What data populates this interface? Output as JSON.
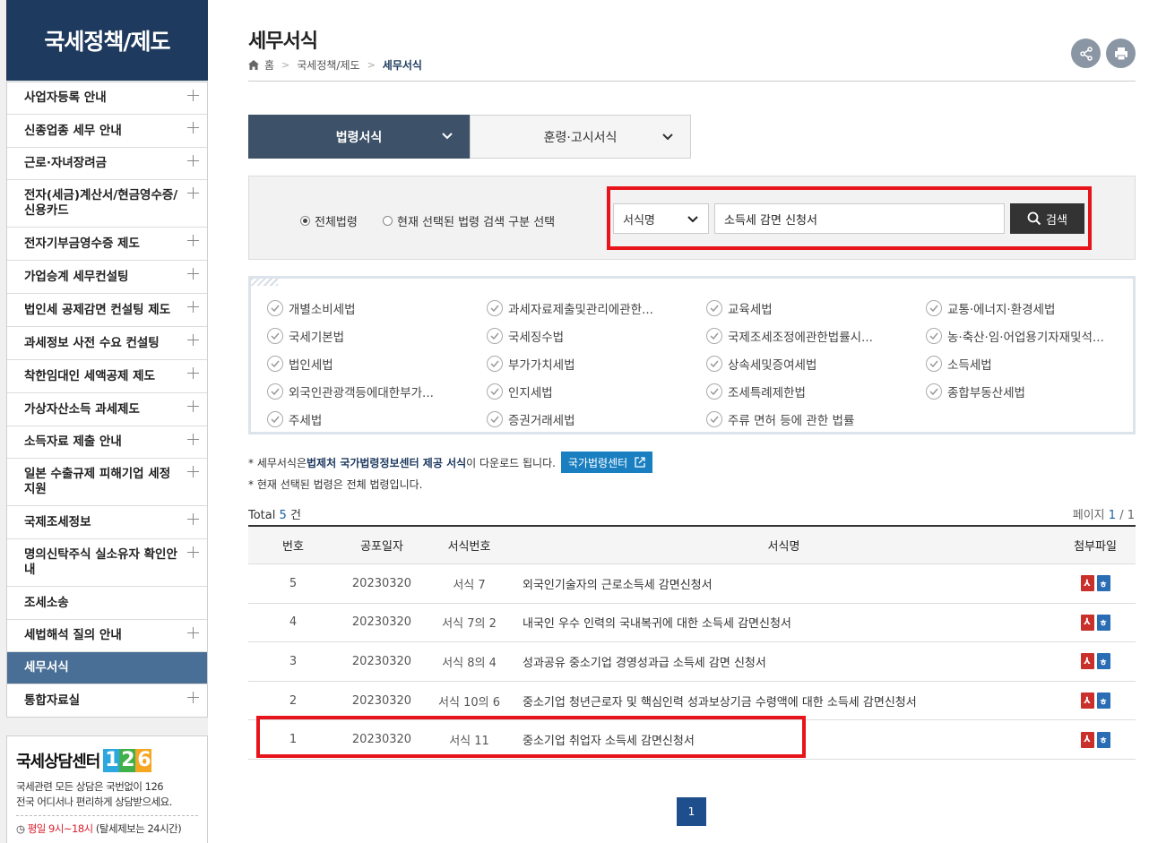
{
  "sidebar": {
    "title": "국세정책/제도",
    "items": [
      {
        "label": "사업자등록 안내",
        "plus": true
      },
      {
        "label": "신종업종 세무 안내",
        "plus": true
      },
      {
        "label": "근로·자녀장려금",
        "plus": true
      },
      {
        "label": "전자(세금)계산서/현금영수증/신용카드",
        "plus": true
      },
      {
        "label": "전자기부금영수증 제도",
        "plus": true
      },
      {
        "label": "가업승계 세무컨설팅",
        "plus": true
      },
      {
        "label": "법인세 공제감면 컨설팅 제도",
        "plus": true
      },
      {
        "label": "과세정보 사전 수요 컨설팅",
        "plus": true
      },
      {
        "label": "착한임대인 세액공제 제도",
        "plus": true
      },
      {
        "label": "가상자산소득 과세제도",
        "plus": true
      },
      {
        "label": "소득자료 제출 안내",
        "plus": true
      },
      {
        "label": "일본 수출규제 피해기업 세정지원",
        "plus": true
      },
      {
        "label": "국제조세정보",
        "plus": true
      },
      {
        "label": "명의신탁주식 실소유자 확인안내",
        "plus": true
      },
      {
        "label": "조세소송",
        "plus": false
      },
      {
        "label": "세법해석 질의 안내",
        "plus": true
      },
      {
        "label": "세무서식",
        "plus": false,
        "active": true
      },
      {
        "label": "통합자료실",
        "plus": true
      }
    ]
  },
  "center": {
    "title": "국세상담센터",
    "digits": [
      "1",
      "2",
      "6"
    ],
    "desc1": "국세관련 모든 상담은 국번없이 126",
    "desc2": "전국 어디서나 편리하게 상담받으세요.",
    "hours_red": "평일 9시~18시",
    "hours_rest": " (탈세제보는 24시간)"
  },
  "header": {
    "title": "세무서식",
    "breadcrumb": [
      "홈",
      "국세정책/제도",
      "세무서식"
    ]
  },
  "tabs": [
    "법령서식",
    "훈령·고시서식"
  ],
  "search": {
    "radio_all": "전체법령",
    "radio_selected": "현재 선택된 법령 검색 구분 선택",
    "select_value": "서식명",
    "query": "소득세 감면 신청서",
    "button": "검색"
  },
  "laws": [
    "개별소비세법",
    "과세자료제출및관리에관한...",
    "교육세법",
    "교통·에너지·환경세법",
    "국세기본법",
    "국세징수법",
    "국제조세조정에관한법률시...",
    "농·축산·임·어업용기자재및석...",
    "법인세법",
    "부가가치세법",
    "상속세및증여세법",
    "소득세법",
    "외국인관광객등에대한부가...",
    "인지세법",
    "조세특례제한법",
    "종합부동산세법",
    "주세법",
    "증권거래세법",
    "주류 면허 등에 관한 법률"
  ],
  "notice": {
    "line1_a": "* 세무서식은 ",
    "line1_strong": "법제처 국가법령정보센터 제공 서식",
    "line1_b": "이 다운로드 됩니다.",
    "law_center_btn": "국가법령센터",
    "line2": "* 현재 선택된 법령은 전체 법령입니다."
  },
  "summary": {
    "total_label": "Total",
    "total_count": "5",
    "total_unit": "건",
    "page_label": "페이지",
    "page_current": "1",
    "page_sep": "/",
    "page_total": "1"
  },
  "table": {
    "headers": [
      "번호",
      "공포일자",
      "서식번호",
      "서식명",
      "첨부파일"
    ],
    "rows": [
      [
        "5",
        "20230320",
        "서식 7",
        "외국인기술자의 근로소득세 감면신청서"
      ],
      [
        "4",
        "20230320",
        "서식 7의 2",
        "내국인 우수 인력의 국내복귀에 대한 소득세 감면신청서"
      ],
      [
        "3",
        "20230320",
        "서식 8의 4",
        "성과공유 중소기업 경영성과급 소득세 감면 신청서"
      ],
      [
        "2",
        "20230320",
        "서식 10의 6",
        "중소기업 청년근로자 및 핵심인력 성과보상기금 수령액에 대한 소득세 감면신청서"
      ],
      [
        "1",
        "20230320",
        "서식 11",
        "중소기업 취업자 소득세 감면신청서"
      ]
    ]
  },
  "pagination": {
    "current": "1"
  },
  "colors": {
    "navy": "#1e3a5f",
    "tab_active": "#3d5168",
    "highlight": "#e8141b",
    "link_blue": "#1a7fc1",
    "digit1": "#2ca7e0",
    "digit2": "#3fb04b",
    "digit3": "#f5a623"
  }
}
